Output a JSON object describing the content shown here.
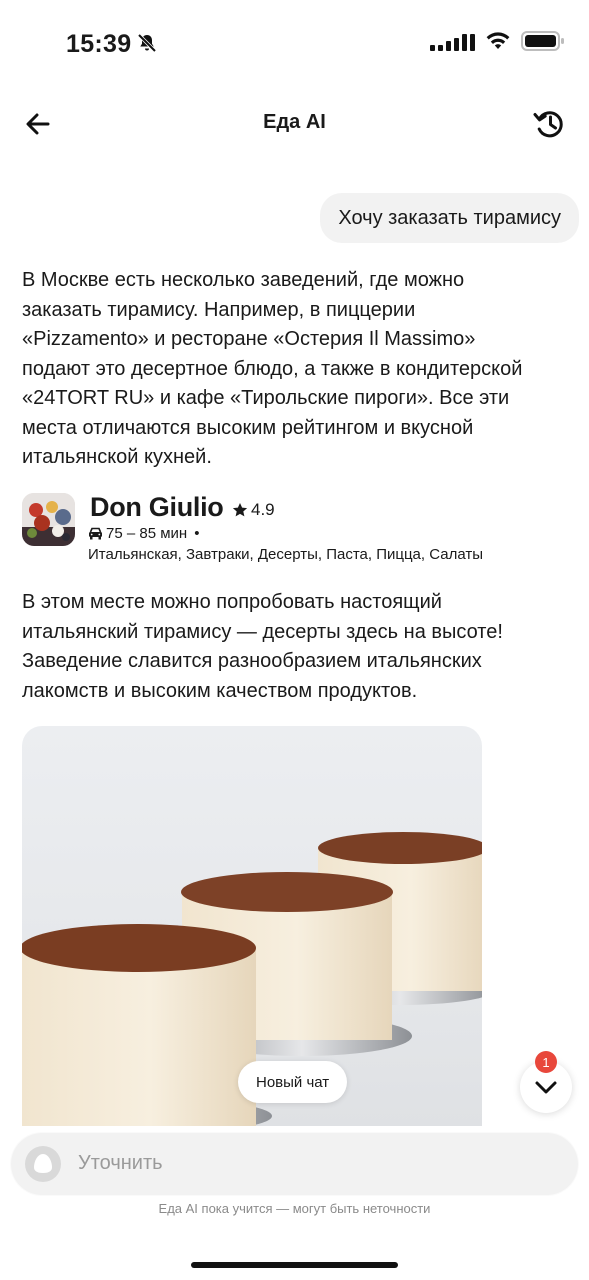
{
  "status_bar": {
    "time": "15:39"
  },
  "header": {
    "title": "Еда AI"
  },
  "chat": {
    "user_message": "Хочу заказать тирамису",
    "assistant_intro_lines": [
      "В Москве есть несколько заведений, где можно",
      "заказать тирамису. Например, в пиццерии",
      "«Pizzamento» и ресторане «Остерия Il Massimo»",
      "подают это десертное блюдо, а также в кондитерской",
      "«24TORT RU» и кафе «Тирольские пироги». Все эти",
      "места отличаются высоким рейтингом и вкусной",
      "итальянской кухней."
    ],
    "restaurant": {
      "name": "Don Giulio",
      "rating": "4.9",
      "delivery_time": "75 – 85 мин",
      "separator": "•",
      "cuisines": "Итальянская, Завтраки, Десерты, Паста, Пицца, Салаты"
    },
    "restaurant_description_lines": [
      "В этом месте можно попробовать настоящий",
      "итальянский тирамису — десерты здесь на высоте!",
      "Заведение славится разнообразием итальянских",
      "лакомств и высоким качеством продуктов."
    ]
  },
  "floating": {
    "new_chat_label": "Новый чат",
    "unread_count": "1"
  },
  "composer": {
    "placeholder": "Уточнить"
  },
  "disclaimer": "Еда AI пока учится — могут быть неточности",
  "icons": {
    "back": "arrow-left-icon",
    "history": "history-clock-icon",
    "delivery": "car-icon",
    "rating": "star-icon",
    "scroll": "chevron-down-icon",
    "assistant": "alice-icon"
  },
  "colors": {
    "badge": "#e8473b",
    "bubble": "#f2f2f2",
    "text": "#1a1a1a"
  }
}
